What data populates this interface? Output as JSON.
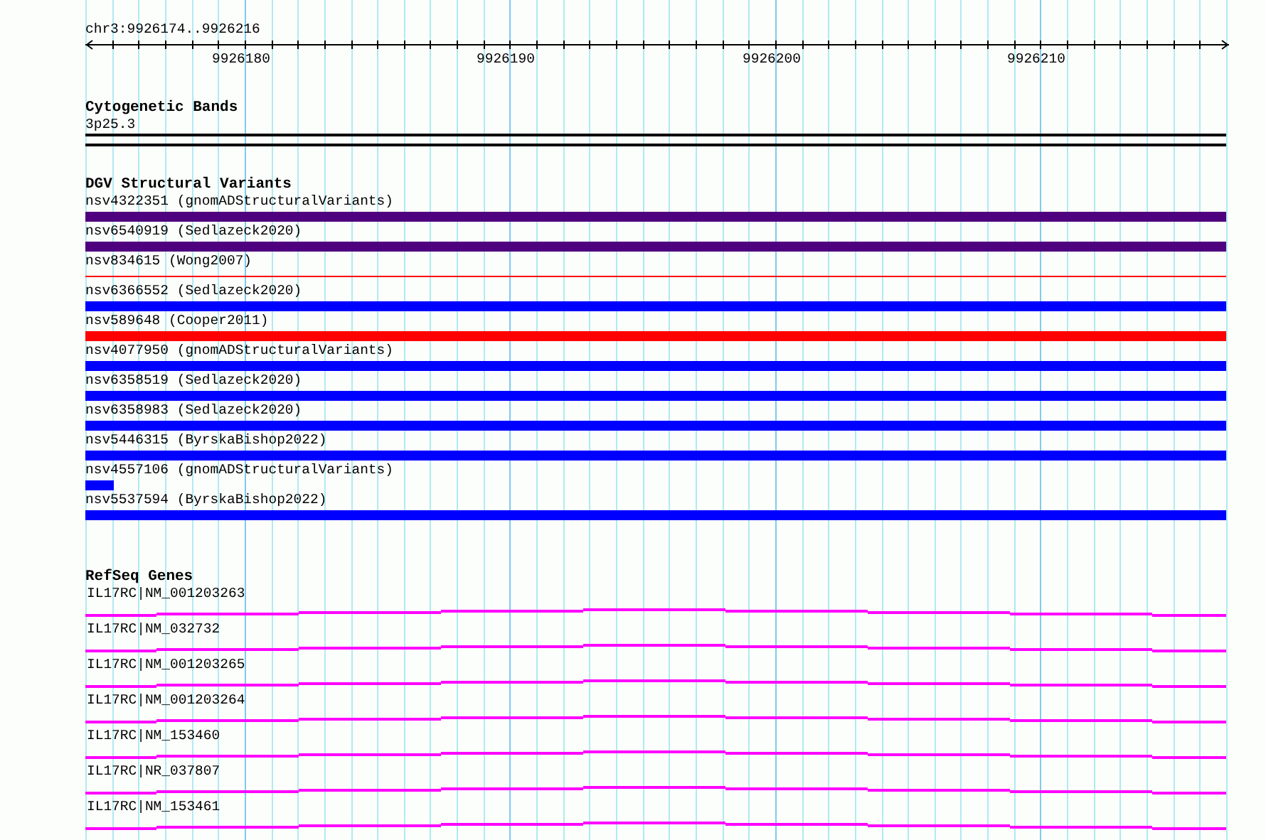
{
  "ruler": {
    "title": "chr3:9926174..9926216",
    "tick_labels": [
      "9926180",
      "9926190",
      "9926200",
      "9926210"
    ]
  },
  "cytogenetic_bands": {
    "title": "Cytogenetic Bands",
    "bands": [
      {
        "name": "3p25.3"
      }
    ]
  },
  "dgv_structural_variants": {
    "title": "DGV Structural Variants",
    "variants": [
      {
        "label": "nsv4322351 (gnomADStructuralVariants)",
        "kind": "bar",
        "color": "#4f007f"
      },
      {
        "label": "nsv6540919 (Sedlazeck2020)",
        "kind": "bar",
        "color": "#4f007f"
      },
      {
        "label": "nsv834615 (Wong2007)",
        "kind": "line",
        "color": "#ff0000"
      },
      {
        "label": "nsv6366552 (Sedlazeck2020)",
        "kind": "bar",
        "color": "#0000ff"
      },
      {
        "label": "nsv589648 (Cooper2011)",
        "kind": "bar",
        "color": "#ff0000"
      },
      {
        "label": "nsv4077950 (gnomADStructuralVariants)",
        "kind": "bar",
        "color": "#0000ff"
      },
      {
        "label": "nsv6358519 (Sedlazeck2020)",
        "kind": "bar",
        "color": "#0000ff"
      },
      {
        "label": "nsv6358983 (Sedlazeck2020)",
        "kind": "bar",
        "color": "#0000ff"
      },
      {
        "label": "nsv5446315 (ByrskaBishop2022)",
        "kind": "bar",
        "color": "#0000ff"
      },
      {
        "label": "nsv4557106 (gnomADStructuralVariants)",
        "kind": "stub",
        "color": "#0000ff"
      },
      {
        "label": "nsv5537594 (ByrskaBishop2022)",
        "kind": "bar",
        "color": "#0000ff"
      }
    ]
  },
  "refseq_genes": {
    "title": "RefSeq Genes",
    "genes": [
      {
        "label": "IL17RC|NM_001203263"
      },
      {
        "label": "IL17RC|NM_032732"
      },
      {
        "label": "IL17RC|NM_001203265"
      },
      {
        "label": "IL17RC|NM_001203264"
      },
      {
        "label": "IL17RC|NM_153460"
      },
      {
        "label": "IL17RC|NR_037807"
      },
      {
        "label": "IL17RC|NM_153461"
      }
    ]
  }
}
